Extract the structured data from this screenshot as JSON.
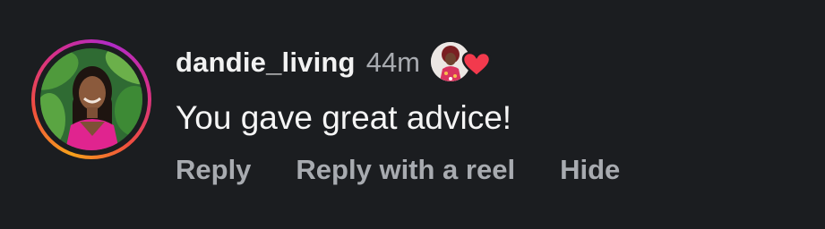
{
  "comment": {
    "username": "dandie_living",
    "time": "44m",
    "text": "You gave great advice!",
    "actions": {
      "reply": "Reply",
      "reply_with_reel": "Reply with a reel",
      "hide": "Hide"
    }
  },
  "icons": {
    "liked": "heart-icon"
  },
  "colors": {
    "background": "#1b1d20",
    "primary_text": "#f2f2f2",
    "secondary_text": "#a8abb0",
    "heart": "#f23a4d",
    "story_ring_start": "#f7a21b",
    "story_ring_end": "#b02bc7"
  }
}
